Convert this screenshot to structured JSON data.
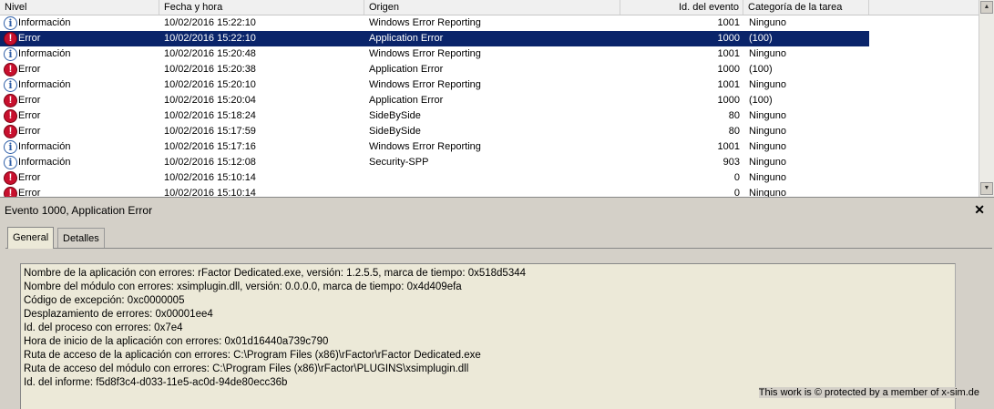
{
  "columns": {
    "level": "Nivel",
    "date": "Fecha y hora",
    "source": "Origen",
    "event_id": "Id. del evento",
    "category": "Categoría de la tarea"
  },
  "events": [
    {
      "type": "info",
      "level": "Información",
      "date": "10/02/2016 15:22:10",
      "source": "Windows Error Reporting",
      "id": "1001",
      "category": "Ninguno"
    },
    {
      "type": "error",
      "level": "Error",
      "date": "10/02/2016 15:22:10",
      "source": "Application Error",
      "id": "1000",
      "category": "(100)",
      "selected": true
    },
    {
      "type": "info",
      "level": "Información",
      "date": "10/02/2016 15:20:48",
      "source": "Windows Error Reporting",
      "id": "1001",
      "category": "Ninguno"
    },
    {
      "type": "error",
      "level": "Error",
      "date": "10/02/2016 15:20:38",
      "source": "Application Error",
      "id": "1000",
      "category": "(100)"
    },
    {
      "type": "info",
      "level": "Información",
      "date": "10/02/2016 15:20:10",
      "source": "Windows Error Reporting",
      "id": "1001",
      "category": "Ninguno"
    },
    {
      "type": "error",
      "level": "Error",
      "date": "10/02/2016 15:20:04",
      "source": "Application Error",
      "id": "1000",
      "category": "(100)"
    },
    {
      "type": "error",
      "level": "Error",
      "date": "10/02/2016 15:18:24",
      "source": "SideBySide",
      "id": "80",
      "category": "Ninguno"
    },
    {
      "type": "error",
      "level": "Error",
      "date": "10/02/2016 15:17:59",
      "source": "SideBySide",
      "id": "80",
      "category": "Ninguno"
    },
    {
      "type": "info",
      "level": "Información",
      "date": "10/02/2016 15:17:16",
      "source": "Windows Error Reporting",
      "id": "1001",
      "category": "Ninguno"
    },
    {
      "type": "info",
      "level": "Información",
      "date": "10/02/2016 15:12:08",
      "source": "Security-SPP",
      "id": "903",
      "category": "Ninguno"
    },
    {
      "type": "error",
      "level": "Error",
      "date": "10/02/2016 15:10:14",
      "source": "",
      "id": "0",
      "category": "Ninguno"
    },
    {
      "type": "error",
      "level": "Error",
      "date": "10/02/2016 15:10:14",
      "source": "",
      "id": "0",
      "category": "Ninguno"
    }
  ],
  "icons": {
    "info": "i",
    "error": "!"
  },
  "detail": {
    "title": "Evento 1000, Application Error",
    "close": "✕",
    "tabs": {
      "general": "General",
      "details": "Detalles"
    },
    "lines": [
      "Nombre de la aplicación con errores: rFactor Dedicated.exe, versión: 1.2.5.5, marca de tiempo: 0x518d5344",
      "Nombre del módulo con errores: xsimplugin.dll, versión: 0.0.0.0, marca de tiempo: 0x4d409efa",
      "Código de excepción: 0xc0000005",
      "Desplazamiento de errores: 0x00001ee4",
      "Id. del proceso con errores: 0x7e4",
      "Hora de inicio de la aplicación con errores: 0x01d16440a739c790",
      "Ruta de acceso de la aplicación con errores: C:\\Program Files (x86)\\rFactor\\rFactor Dedicated.exe",
      "Ruta de acceso del módulo con errores: C:\\Program Files (x86)\\rFactor\\PLUGINS\\xsimplugin.dll",
      "Id. del informe: f5d8f3c4-d033-11e5-ac0d-94de80ecc36b"
    ]
  },
  "scroll": {
    "up": "▲",
    "down": "▼"
  },
  "watermark": "This work is © protected by a member of x-sim.de",
  "colors": {
    "selection": "#0a246a",
    "error": "#c8102e",
    "info": "#2f5fa8"
  }
}
